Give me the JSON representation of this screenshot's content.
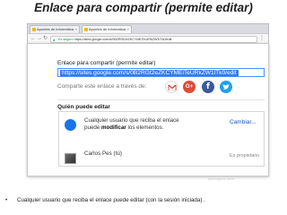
{
  "slide": {
    "title": "Enlace para compartir (permite editar)",
    "caption": "Cualquier usuario que reciba el enlace puede editar (con la sesión iniciada) .",
    "bullet": "•",
    "watermark": "carlospes.com"
  },
  "browser": {
    "tabs": [
      {
        "label": "Apuntes de informática"
      },
      {
        "label": "Apuntes de informática"
      }
    ],
    "back_glyph": "←",
    "forward_glyph": "→",
    "reload_glyph": "↻",
    "lock_glyph": "🔒",
    "address_secure": "Es seguro",
    "address_url": "https://sites.google.com/s/0B2RGt2eZKCYMEiTeURkZW1lTk0/edit",
    "close_glyph": "×",
    "menu_glyph": "⋮"
  },
  "dialog": {
    "title": "Enlace para compartir (permite editar)",
    "link_value": "https://sites.google.com/s/0B2RGt2eZKCYMEiTeURkZW1lTk0/edit",
    "share_label": "Comparte este enlace a través de:",
    "social": {
      "gmail_icon": "gmail-icon",
      "gplus_label": "G+",
      "facebook_label": "f",
      "twitter_icon": "twitter-icon"
    },
    "who_title": "Quién puede editar",
    "permission_text_1": "Cualquier usuario que reciba el enlace",
    "permission_text_2_pre": "puede ",
    "permission_text_2_bold": "modificar",
    "permission_text_2_post": " los elementos.",
    "change_label": "Cambiar...",
    "owner_name": "Carlos Pes (tú)",
    "owner_role": "Es propietario"
  },
  "colors": {
    "link_highlight": "#3b78e7",
    "link_blue": "#1155cc",
    "gplus": "#dd4b39",
    "facebook": "#3b5998",
    "twitter": "#1da1f2"
  }
}
